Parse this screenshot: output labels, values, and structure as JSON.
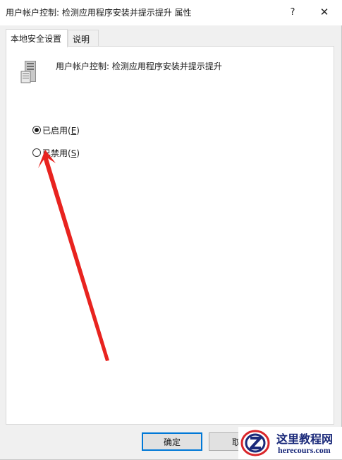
{
  "window": {
    "title": "用户帐户控制: 检测应用程序安装并提示提升 属性",
    "help_glyph": "?",
    "close_glyph": "✕"
  },
  "tabs": [
    {
      "label": "本地安全设置",
      "selected": true
    },
    {
      "label": "说明",
      "selected": false
    }
  ],
  "policy": {
    "icon": "server-policy-icon",
    "name": "用户帐户控制: 检测应用程序安装并提示提升"
  },
  "options": {
    "enabled": {
      "label": "已启用(",
      "key": "E",
      "suffix": ")",
      "checked": true
    },
    "disabled": {
      "label": "已禁用(",
      "key": "S",
      "suffix": ")",
      "checked": false
    }
  },
  "buttons": {
    "ok_label": "确定",
    "cancel_label": "取"
  },
  "annotation": {
    "arrow_color": "#e8231f"
  },
  "watermark": {
    "title": "这里教程网",
    "url": "herecours.com"
  }
}
